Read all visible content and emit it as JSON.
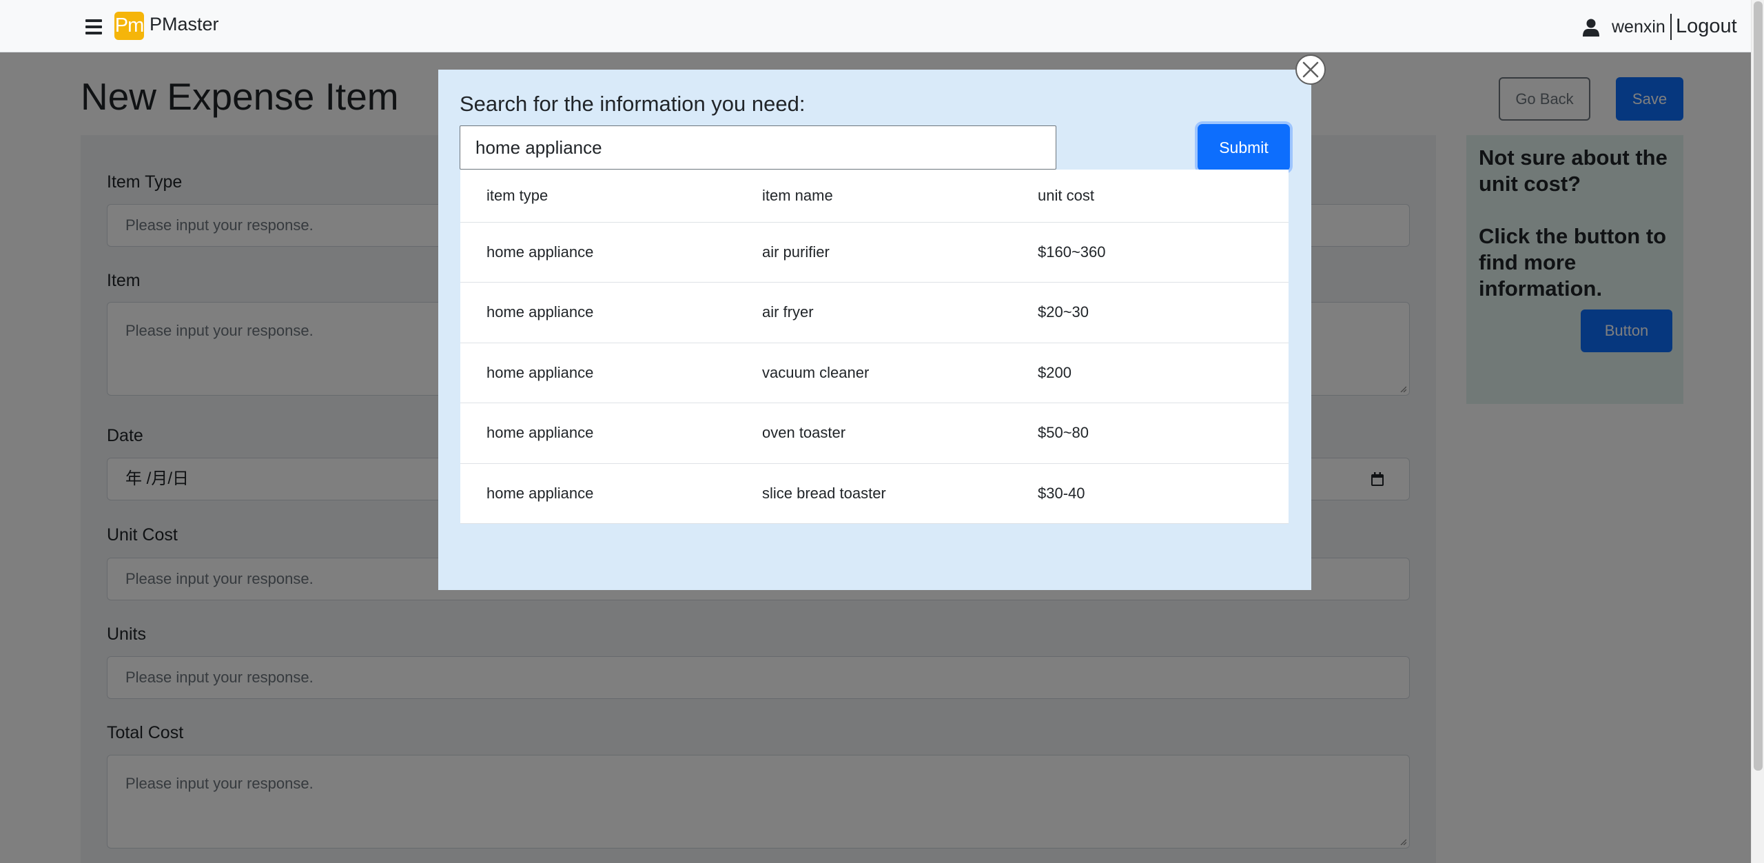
{
  "navbar": {
    "brand_logo": "Pm",
    "brand_name": "PMaster",
    "user_name": "wenxin",
    "logout_label": "Logout",
    "icons": {
      "menu": "hamburger-menu-icon",
      "user": "user-icon"
    }
  },
  "page": {
    "title": "New Expense Item",
    "go_back_label": "Go Back",
    "save_label": "Save"
  },
  "form": {
    "fields": [
      {
        "label": "Item Type",
        "placeholder": "Please input your response."
      },
      {
        "label": "Item",
        "placeholder": "Please input your response."
      },
      {
        "label": "Date",
        "value": "年 /月/日"
      },
      {
        "label": "Unit Cost",
        "placeholder": "Please input your response."
      },
      {
        "label": "Units",
        "placeholder": "Please input your response."
      },
      {
        "label": "Total Cost",
        "placeholder": "Please input your response."
      }
    ]
  },
  "helper": {
    "text_line1": "Not sure about the unit cost?",
    "text_line2": "Click the button to find more information.",
    "button_label": "Button"
  },
  "modal": {
    "heading": "Search for the information you need:",
    "search_value": "home appliance",
    "submit_label": "Submit",
    "table": {
      "headers": [
        "item type",
        "item name",
        "unit cost"
      ],
      "rows": [
        [
          "home appliance",
          "air purifier",
          "$160~360"
        ],
        [
          "home appliance",
          "air fryer",
          "$20~30"
        ],
        [
          "home appliance",
          "vacuum cleaner",
          "$200"
        ],
        [
          "home appliance",
          "oven toaster",
          "$50~80"
        ],
        [
          "home appliance",
          "slice bread toaster",
          "$30-40"
        ]
      ]
    }
  },
  "colors": {
    "primary": "#0d6efd",
    "brand": "#f5b50a",
    "modal_bg": "#d9eaf9",
    "helper_bg": "#e3f3ef"
  }
}
